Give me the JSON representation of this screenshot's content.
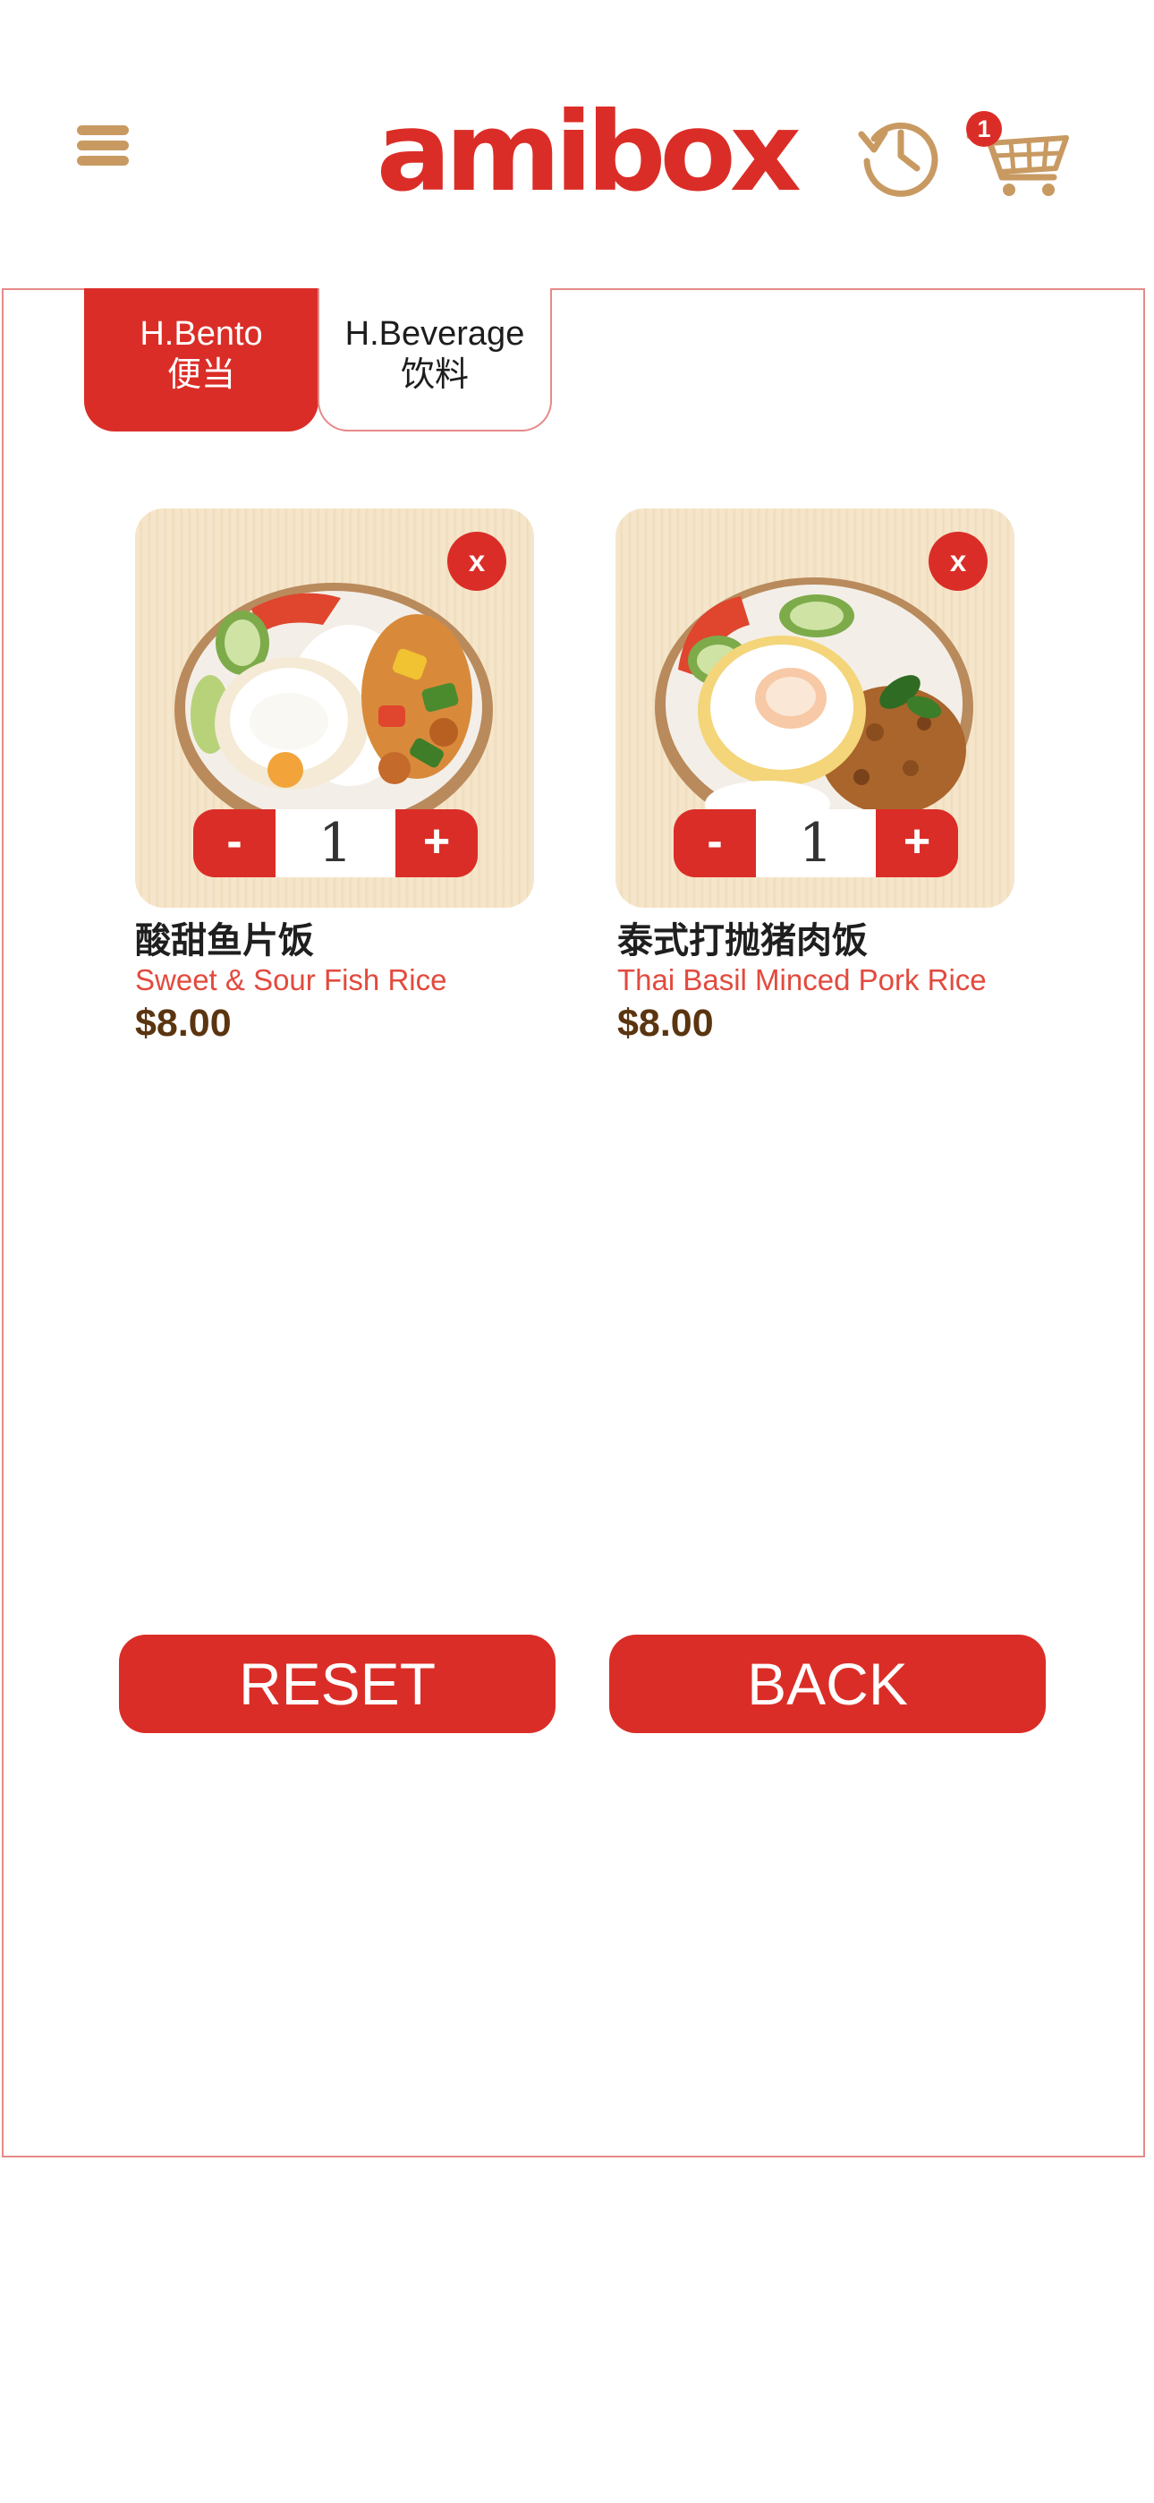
{
  "header": {
    "logo_text": "amibox",
    "cart_count": "1",
    "icons": {
      "menu": "hamburger-menu-icon",
      "history": "history-clock-icon",
      "cart": "shopping-cart-icon"
    },
    "colors": {
      "brand_red": "#db2d27",
      "accent_gold": "#c89a62"
    }
  },
  "tabs": [
    {
      "label_en": "H.Bento",
      "label_zh": "便当",
      "active": true
    },
    {
      "label_en": "H.Beverage",
      "label_zh": "饮料",
      "active": false
    }
  ],
  "cart_items": [
    {
      "name_zh": "酸甜鱼片饭",
      "name_en": "Sweet & Sour Fish Rice",
      "price": "$8.00",
      "quantity": "1",
      "remove_label": "x",
      "minus_label": "-",
      "plus_label": "+"
    },
    {
      "name_zh": "泰式打抛猪肉饭",
      "name_en": "Thai Basil Minced Pork Rice",
      "price": "$8.00",
      "quantity": "1",
      "remove_label": "x",
      "minus_label": "-",
      "plus_label": "+"
    }
  ],
  "actions": {
    "reset_label": "RESET",
    "back_label": "BACK"
  }
}
